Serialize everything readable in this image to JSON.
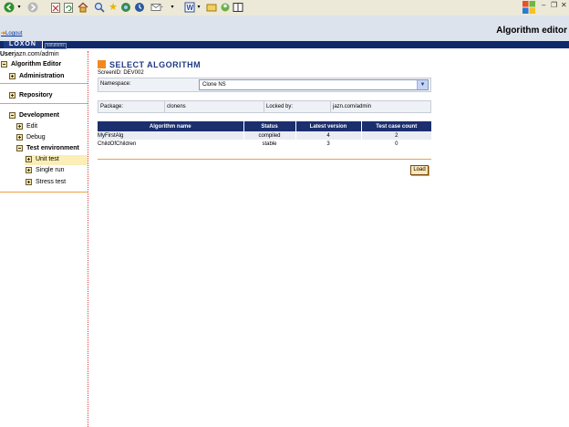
{
  "browser": {
    "toolbar_icons": [
      "back-icon",
      "dropdown-icon",
      "forward-icon",
      "stop-icon",
      "refresh-icon",
      "home-icon",
      "search-icon",
      "favorites-icon",
      "media-icon",
      "history-icon",
      "mail-icon",
      "word-icon",
      "folder-icon",
      "messenger-icon"
    ],
    "window_controls": {
      "minimize": "–",
      "restore": "❐",
      "close": "✕"
    }
  },
  "header": {
    "logout_label": "Logout",
    "app_title": "Algorithm editor",
    "logo_text": "LOXON",
    "logo_sub": "solutions"
  },
  "sidebar": {
    "user_prefix": "User",
    "user_name": "jazn.com/admin",
    "root_label": "Algorithm Editor",
    "groups": {
      "administration": "Administration",
      "repository": "Repository",
      "development": "Development"
    },
    "dev_items": {
      "edit": "Edit",
      "debug": "Debug",
      "test_environment": "Test environment",
      "unit_test": "Unit test",
      "single_run": "Single run",
      "stress_test": "Stress test"
    }
  },
  "main": {
    "title": "SELECT ALGORITHM",
    "screen_id": "ScreenID: DEV002",
    "namespace_label": "Namespace:",
    "namespace_value": "Clone NS",
    "package_label": "Package:",
    "package_value": "clonens",
    "locked_label": "Locked by:",
    "locked_value": "jazn.com/admin",
    "table": {
      "headers": [
        "Algorithm name",
        "Status",
        "Latest version",
        "Test case count"
      ],
      "rows": [
        [
          "MyFirstAlg",
          "compiled",
          "4",
          "2"
        ],
        [
          "ChildOfChildren",
          "stable",
          "3",
          "0"
        ]
      ]
    },
    "load_label": "Load"
  },
  "colors": {
    "accent_orange": "#f08a20",
    "header_blue": "#1b2e6e",
    "title_blue": "#1e3a82"
  }
}
